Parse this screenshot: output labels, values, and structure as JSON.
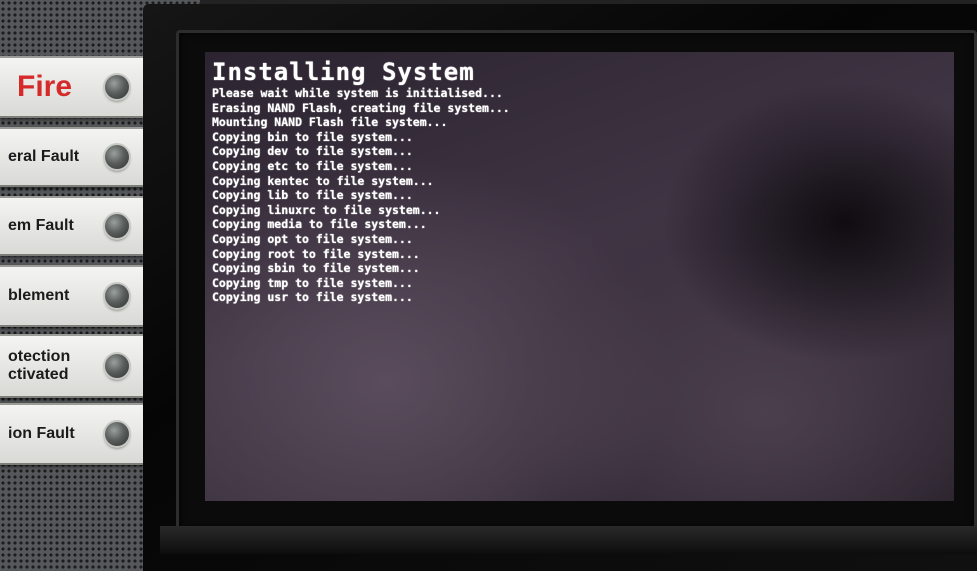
{
  "indicators": [
    {
      "label": "Fire",
      "led_state": "off"
    },
    {
      "label": "eral Fault",
      "led_state": "off"
    },
    {
      "label": "em Fault",
      "led_state": "off"
    },
    {
      "label": "blement",
      "led_state": "off"
    },
    {
      "label": "otection\nctivated",
      "led_state": "off"
    },
    {
      "label": "ion Fault",
      "led_state": "off"
    }
  ],
  "colors": {
    "fire_label": "#d62a2a",
    "terminal_text": "#ffffff",
    "screen_background": "#3f3443"
  },
  "terminal": {
    "title": "Installing System",
    "lines": [
      "Please wait while system is initialised...",
      "Erasing NAND Flash, creating file system...",
      "Mounting NAND Flash file system...",
      "Copying bin to file system...",
      "Copying dev to file system...",
      "Copying etc to file system...",
      "Copying kentec to file system...",
      "Copying lib to file system...",
      "Copying linuxrc to file system...",
      "Copying media to file system...",
      "Copying opt to file system...",
      "Copying root to file system...",
      "Copying sbin to file system...",
      "Copying tmp to file system...",
      "Copying usr to file system..."
    ]
  }
}
